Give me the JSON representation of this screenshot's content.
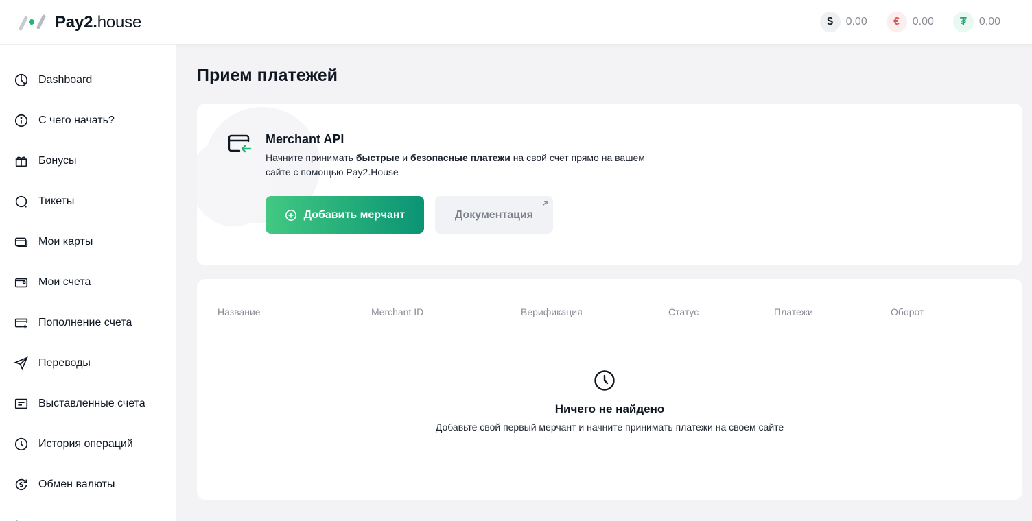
{
  "header": {
    "logo_bold": "Pay2.",
    "logo_light": "house",
    "balances": [
      {
        "symbol": "$",
        "value": "0.00",
        "icon": "dollar-icon",
        "bg": "#eef0f2",
        "fg": "#0f1722"
      },
      {
        "symbol": "€",
        "value": "0.00",
        "icon": "euro-icon",
        "bg": "#fbeeee",
        "fg": "#d9534f"
      },
      {
        "symbol": "₮",
        "value": "0.00",
        "icon": "tether-icon",
        "bg": "#e9f8f1",
        "fg": "#26a17b"
      }
    ]
  },
  "sidebar": {
    "items": [
      {
        "label": "Dashboard",
        "icon": "pie-chart-icon"
      },
      {
        "label": "С чего начать?",
        "icon": "info-icon"
      },
      {
        "label": "Бонусы",
        "icon": "gift-icon"
      },
      {
        "label": "Тикеты",
        "icon": "chat-icon"
      },
      {
        "label": "Мои карты",
        "icon": "cards-icon"
      },
      {
        "label": "Мои счета",
        "icon": "wallet-icon"
      },
      {
        "label": "Пополнение счета",
        "icon": "card-add-icon"
      },
      {
        "label": "Переводы",
        "icon": "send-icon"
      },
      {
        "label": "Выставленные счета",
        "icon": "invoice-icon"
      },
      {
        "label": "История операций",
        "icon": "clock-icon"
      },
      {
        "label": "Обмен валюты",
        "icon": "exchange-icon"
      }
    ]
  },
  "main": {
    "title": "Прием платежей",
    "merchant": {
      "title": "Merchant API",
      "desc_1": "Начните принимать ",
      "desc_b1": "быстрые",
      "desc_2": " и ",
      "desc_b2": "безопасные платежи",
      "desc_3": " на свой счет прямо на вашем сайте с помощью Pay2.House",
      "add_button": "Добавить мерчант",
      "docs_button": "Документация"
    },
    "table": {
      "columns": [
        "Название",
        "Merchant ID",
        "Верификация",
        "Статус",
        "Платежи",
        "Оборот"
      ],
      "empty_title": "Ничего не найдено",
      "empty_subtitle": "Добавьте свой первый мерчант и начните принимать платежи на своем сайте"
    }
  },
  "colors": {
    "accent_start": "#42c982",
    "accent_end": "#0a9474"
  }
}
